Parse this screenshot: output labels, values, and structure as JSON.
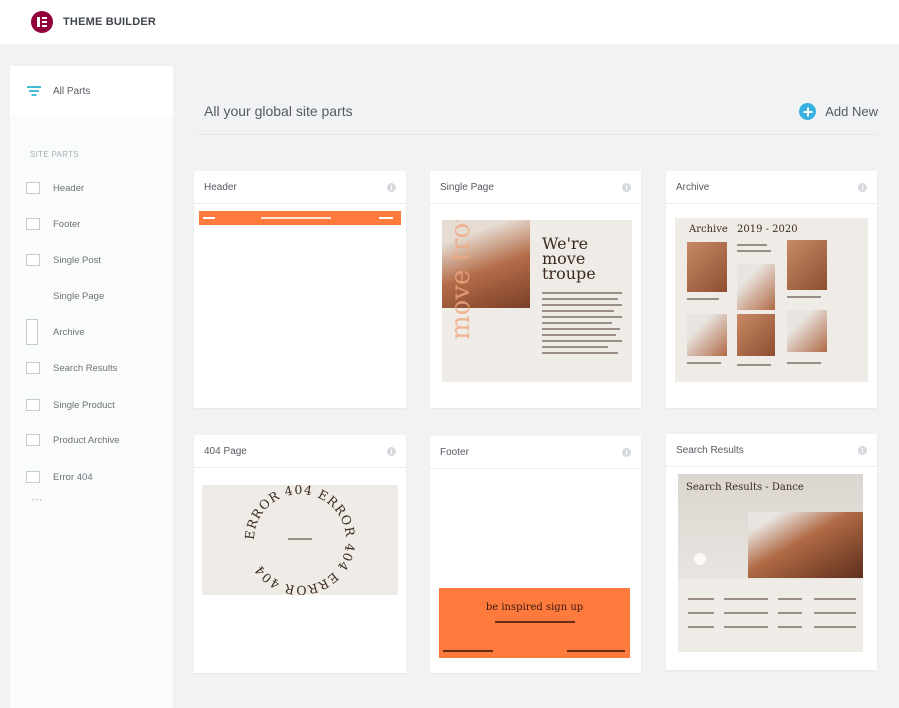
{
  "app": {
    "title": "THEME BUILDER"
  },
  "sidebar": {
    "all_parts_label": "All Parts",
    "section_title": "SITE PARTS",
    "items": [
      {
        "label": "Header",
        "icon": "header-icon"
      },
      {
        "label": "Footer",
        "icon": "footer-icon"
      },
      {
        "label": "Single Post",
        "icon": "single-post-icon"
      },
      {
        "label": "Single Page",
        "icon": ""
      },
      {
        "label": "Archive",
        "icon": "archive-icon"
      },
      {
        "label": "Search Results",
        "icon": "search-results-icon"
      },
      {
        "label": "Single Product",
        "icon": "single-product-icon"
      },
      {
        "label": "Product Archive",
        "icon": "product-archive-icon"
      },
      {
        "label": "Error 404",
        "icon": "error-404-icon"
      }
    ]
  },
  "main": {
    "title": "All your global site parts",
    "add_new_label": "Add New",
    "cards": [
      {
        "title": "Header"
      },
      {
        "title": "Single Page"
      },
      {
        "title": "Archive"
      },
      {
        "title": "404 Page"
      },
      {
        "title": "Footer"
      },
      {
        "title": "Search Results"
      }
    ]
  },
  "previews": {
    "single_page_heading": "We're move troupe",
    "single_page_vertical": "move troupe",
    "archive_heading": "Archive",
    "archive_years": "2019 - 2020",
    "error_ring": "ERROR 404 ERROR 404 ERROR 404 ",
    "footer_cta": "be inspired sign up",
    "search_heading": "Search Results - Dance"
  },
  "colors": {
    "accent": "#ff7a3d",
    "brand": "#92003b",
    "add": "#39b1e0",
    "paper": "#efebe6"
  }
}
